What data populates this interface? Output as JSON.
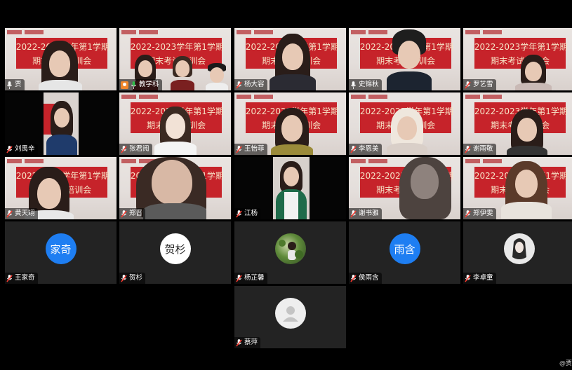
{
  "banner": {
    "line1": "2022-2023学年第1学期",
    "line2": "期末考试培训会"
  },
  "participants": [
    {
      "name": "贾",
      "mic": "on",
      "type": "video"
    },
    {
      "name": "教学科",
      "mic": "on",
      "host": true,
      "type": "video",
      "speaking": true
    },
    {
      "name": "杨大容",
      "mic": "off",
      "type": "video"
    },
    {
      "name": "史锦秋",
      "mic": "on",
      "type": "video"
    },
    {
      "name": "罗艺雪",
      "mic": "off",
      "type": "video"
    },
    {
      "name": "刘禹辛",
      "mic": "off",
      "type": "video"
    },
    {
      "name": "张君阅",
      "mic": "off",
      "type": "video"
    },
    {
      "name": "王怡菲",
      "mic": "off",
      "type": "video"
    },
    {
      "name": "李恩美",
      "mic": "off",
      "type": "video"
    },
    {
      "name": "谢雨敬",
      "mic": "off",
      "type": "video"
    },
    {
      "name": "黄天翊",
      "mic": "off",
      "type": "video"
    },
    {
      "name": "郑晋",
      "mic": "off",
      "type": "video"
    },
    {
      "name": "江杨",
      "mic": "off",
      "type": "video"
    },
    {
      "name": "谢书雅",
      "mic": "off",
      "type": "video"
    },
    {
      "name": "郑伊雯",
      "mic": "off",
      "type": "video"
    },
    {
      "name": "王家奇",
      "mic": "off",
      "type": "avatar",
      "avatar_text": "家奇",
      "avatar_color": "#1e7ef2"
    },
    {
      "name": "贺杉",
      "mic": "off",
      "type": "avatar",
      "avatar_text": "贺杉",
      "avatar_color": "#ffffff"
    },
    {
      "name": "杨芷馨",
      "mic": "off",
      "type": "avatar-photo"
    },
    {
      "name": "侯雨含",
      "mic": "off",
      "type": "avatar",
      "avatar_text": "雨含",
      "avatar_color": "#1e7ef2"
    },
    {
      "name": "李卓童",
      "mic": "off",
      "type": "avatar-photo"
    },
    {
      "name": "蔡萍",
      "mic": "off",
      "type": "avatar-default"
    }
  ],
  "corner_text": "@贾",
  "colors": {
    "banner_red": "#c6232a",
    "active_speaker_border": "#2fbf4a",
    "host_badge": "#f1862b",
    "muted_mic": "#ff3b30",
    "avatar_blue": "#1e7ef2"
  }
}
